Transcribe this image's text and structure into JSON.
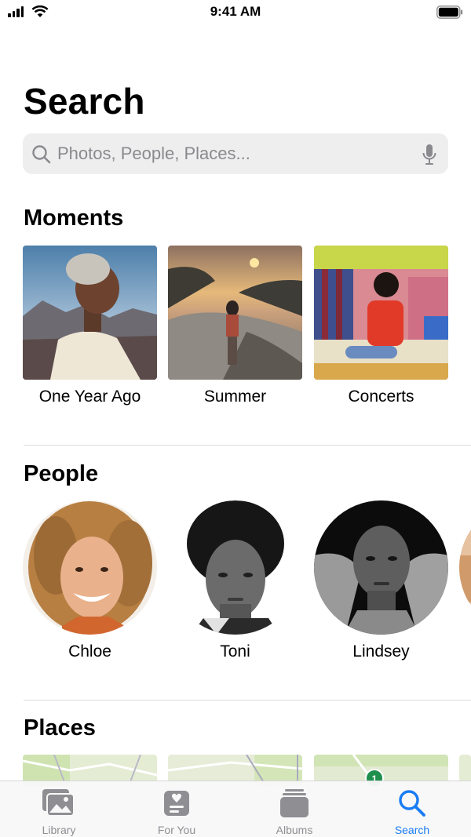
{
  "status_bar": {
    "time": "9:41 AM"
  },
  "header": {
    "title": "Search"
  },
  "search": {
    "placeholder": "Photos, People, Places..."
  },
  "moments": {
    "title": "Moments",
    "items": [
      {
        "label": "One Year Ago"
      },
      {
        "label": "Summer"
      },
      {
        "label": "Concerts"
      }
    ]
  },
  "people": {
    "title": "People",
    "items": [
      {
        "name": "Chloe"
      },
      {
        "name": "Toni"
      },
      {
        "name": "Lindsey"
      }
    ]
  },
  "places": {
    "title": "Places",
    "map_badge": "1"
  },
  "tab_bar": {
    "items": [
      {
        "label": "Library",
        "icon": "photo-stack-icon"
      },
      {
        "label": "For You",
        "icon": "heart-card-icon"
      },
      {
        "label": "Albums",
        "icon": "album-stack-icon"
      },
      {
        "label": "Search",
        "icon": "search-icon"
      }
    ],
    "active": "Search"
  },
  "colors": {
    "accent": "#1a7cf5",
    "search_bg": "#eeeeef",
    "placeholder": "#8a8a8e",
    "inactive_tab": "#8e8e93"
  }
}
